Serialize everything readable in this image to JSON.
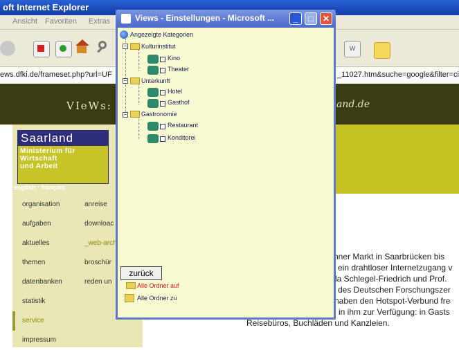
{
  "browser": {
    "title": "oft Internet Explorer",
    "menu": [
      "Ansicht",
      "Favoriten",
      "Extras"
    ],
    "address_left": "ews.dfki.de/frameset.php?url=UF",
    "address_right": "_11027.htm&suche=google&filter=ci"
  },
  "site": {
    "logo_left": "VIeWs:",
    "logo_right": "and.de",
    "ministry_title": "Saarland",
    "ministry_lines": [
      "Ministerium für",
      "Wirtschaft",
      "und Arbeit"
    ],
    "language": "english · français",
    "nav_left": [
      "organisation",
      "aufgaben",
      "aktuelles",
      "themen",
      "datenbanken",
      "statistik",
      "service",
      "impressum"
    ],
    "nav_right": [
      "anreise",
      "downloac",
      "_web-arch",
      "broschür",
      "reden un"
    ],
    "body_lines": [
      "nner Markt in Saarbrücken bis",
      "ein drahtloser Internetzugang v",
      "la Schlegel-Friedrich und Prof.",
      "des Deutschen Forschungszer",
      "haben den Hotspot-Verbund fre",
      "n in ihm zur Verfügung: in Gasts",
      "Reisebüros, Buchläden und Kanzleien."
    ]
  },
  "dialog": {
    "title": "Views - Einstellungen - Microsoft ...",
    "root": "Angezeigte Kategorien",
    "categories": [
      {
        "name": "Kulturinstitut",
        "items": [
          "Kino",
          "Theater"
        ]
      },
      {
        "name": "Unterkunft",
        "items": [
          "Hotel",
          "Gasthof"
        ]
      },
      {
        "name": "Gastronomie",
        "items": [
          "Restaurant",
          "Konditorei"
        ]
      }
    ],
    "back_button": "zurück",
    "open_all": "Alle Ordner auf",
    "close_all": "Alle Ordner zu"
  }
}
